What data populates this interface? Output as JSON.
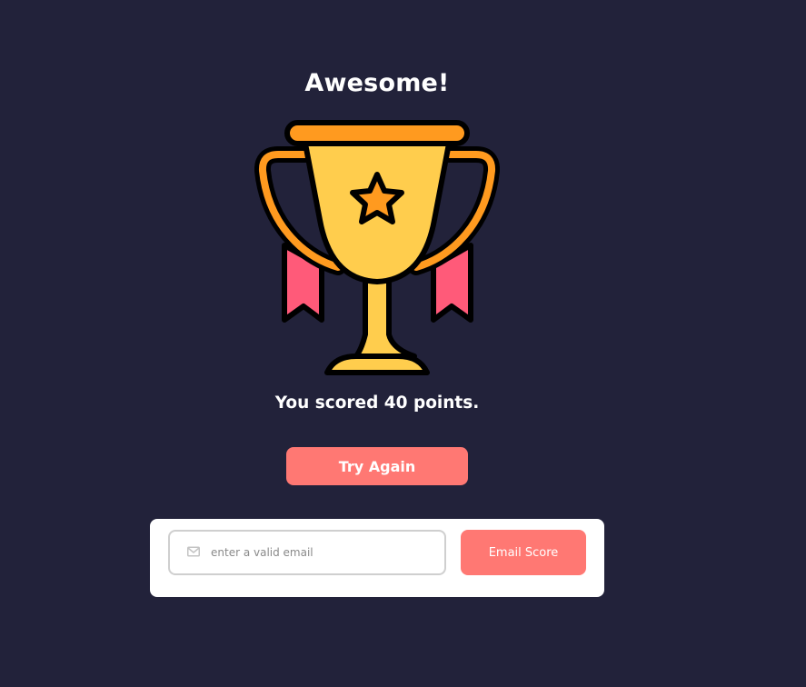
{
  "result": {
    "title": "Awesome!",
    "score_text": "You scored 40 points."
  },
  "actions": {
    "try_again_label": "Try Again"
  },
  "email_form": {
    "placeholder": "enter a valid email",
    "value": "",
    "submit_label": "Email Score"
  },
  "icons": {
    "trophy": "trophy-icon",
    "mail": "mail-icon"
  },
  "colors": {
    "background": "#22223a",
    "accent": "#ff7873",
    "card": "#ffffff",
    "trophy_gold": "#ffcd4d",
    "trophy_orange": "#ff9a1f",
    "ribbon": "#ff5a79"
  }
}
